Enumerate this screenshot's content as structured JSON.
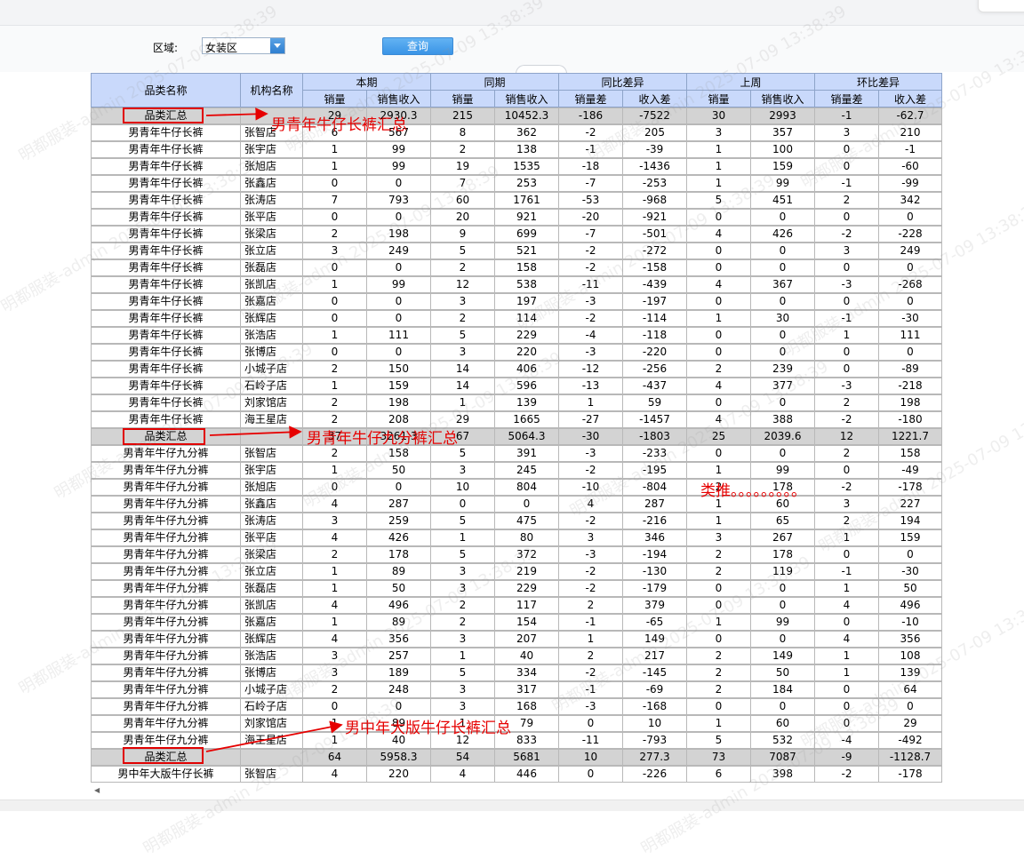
{
  "filter": {
    "region_label": "区域:",
    "region_value": "女装区",
    "query_label": "查询"
  },
  "headers": {
    "category": "品类名称",
    "store": "机构名称",
    "groups": [
      "本期",
      "同期",
      "同比差异",
      "上周",
      "环比差异"
    ],
    "sub": [
      "销量",
      "销售收入",
      "销量",
      "销售收入",
      "销量差",
      "收入差",
      "销量",
      "销售收入",
      "销量差",
      "收入差"
    ]
  },
  "rows": [
    [
      "品类汇总",
      "",
      "29",
      "2930.3",
      "215",
      "10452.3",
      "-186",
      "-7522",
      "30",
      "2993",
      "-1",
      "-62.7"
    ],
    [
      "男青年牛仔长裤",
      "张智店",
      "6",
      "567",
      "8",
      "362",
      "-2",
      "205",
      "3",
      "357",
      "3",
      "210"
    ],
    [
      "男青年牛仔长裤",
      "张宇店",
      "1",
      "99",
      "2",
      "138",
      "-1",
      "-39",
      "1",
      "100",
      "0",
      "-1"
    ],
    [
      "男青年牛仔长裤",
      "张旭店",
      "1",
      "99",
      "19",
      "1535",
      "-18",
      "-1436",
      "1",
      "159",
      "0",
      "-60"
    ],
    [
      "男青年牛仔长裤",
      "张鑫店",
      "0",
      "0",
      "7",
      "253",
      "-7",
      "-253",
      "1",
      "99",
      "-1",
      "-99"
    ],
    [
      "男青年牛仔长裤",
      "张涛店",
      "7",
      "793",
      "60",
      "1761",
      "-53",
      "-968",
      "5",
      "451",
      "2",
      "342"
    ],
    [
      "男青年牛仔长裤",
      "张平店",
      "0",
      "0",
      "20",
      "921",
      "-20",
      "-921",
      "0",
      "0",
      "0",
      "0"
    ],
    [
      "男青年牛仔长裤",
      "张梁店",
      "2",
      "198",
      "9",
      "699",
      "-7",
      "-501",
      "4",
      "426",
      "-2",
      "-228"
    ],
    [
      "男青年牛仔长裤",
      "张立店",
      "3",
      "249",
      "5",
      "521",
      "-2",
      "-272",
      "0",
      "0",
      "3",
      "249"
    ],
    [
      "男青年牛仔长裤",
      "张磊店",
      "0",
      "0",
      "2",
      "158",
      "-2",
      "-158",
      "0",
      "0",
      "0",
      "0"
    ],
    [
      "男青年牛仔长裤",
      "张凯店",
      "1",
      "99",
      "12",
      "538",
      "-11",
      "-439",
      "4",
      "367",
      "-3",
      "-268"
    ],
    [
      "男青年牛仔长裤",
      "张嘉店",
      "0",
      "0",
      "3",
      "197",
      "-3",
      "-197",
      "0",
      "0",
      "0",
      "0"
    ],
    [
      "男青年牛仔长裤",
      "张辉店",
      "0",
      "0",
      "2",
      "114",
      "-2",
      "-114",
      "1",
      "30",
      "-1",
      "-30"
    ],
    [
      "男青年牛仔长裤",
      "张浩店",
      "1",
      "111",
      "5",
      "229",
      "-4",
      "-118",
      "0",
      "0",
      "1",
      "111"
    ],
    [
      "男青年牛仔长裤",
      "张博店",
      "0",
      "0",
      "3",
      "220",
      "-3",
      "-220",
      "0",
      "0",
      "0",
      "0"
    ],
    [
      "男青年牛仔长裤",
      "小城子店",
      "2",
      "150",
      "14",
      "406",
      "-12",
      "-256",
      "2",
      "239",
      "0",
      "-89"
    ],
    [
      "男青年牛仔长裤",
      "石岭子店",
      "1",
      "159",
      "14",
      "596",
      "-13",
      "-437",
      "4",
      "377",
      "-3",
      "-218"
    ],
    [
      "男青年牛仔长裤",
      "刘家馆店",
      "2",
      "198",
      "1",
      "139",
      "1",
      "59",
      "0",
      "0",
      "2",
      "198"
    ],
    [
      "男青年牛仔长裤",
      "海王星店",
      "2",
      "208",
      "29",
      "1665",
      "-27",
      "-1457",
      "4",
      "388",
      "-2",
      "-180"
    ],
    [
      "品类汇总",
      "",
      "37",
      "3261.3",
      "67",
      "5064.3",
      "-30",
      "-1803",
      "25",
      "2039.6",
      "12",
      "1221.7"
    ],
    [
      "男青年牛仔九分裤",
      "张智店",
      "2",
      "158",
      "5",
      "391",
      "-3",
      "-233",
      "0",
      "0",
      "2",
      "158"
    ],
    [
      "男青年牛仔九分裤",
      "张宇店",
      "1",
      "50",
      "3",
      "245",
      "-2",
      "-195",
      "1",
      "99",
      "0",
      "-49"
    ],
    [
      "男青年牛仔九分裤",
      "张旭店",
      "0",
      "0",
      "10",
      "804",
      "-10",
      "-804",
      "2",
      "178",
      "-2",
      "-178"
    ],
    [
      "男青年牛仔九分裤",
      "张鑫店",
      "4",
      "287",
      "0",
      "0",
      "4",
      "287",
      "1",
      "60",
      "3",
      "227"
    ],
    [
      "男青年牛仔九分裤",
      "张涛店",
      "3",
      "259",
      "5",
      "475",
      "-2",
      "-216",
      "1",
      "65",
      "2",
      "194"
    ],
    [
      "男青年牛仔九分裤",
      "张平店",
      "4",
      "426",
      "1",
      "80",
      "3",
      "346",
      "3",
      "267",
      "1",
      "159"
    ],
    [
      "男青年牛仔九分裤",
      "张梁店",
      "2",
      "178",
      "5",
      "372",
      "-3",
      "-194",
      "2",
      "178",
      "0",
      "0"
    ],
    [
      "男青年牛仔九分裤",
      "张立店",
      "1",
      "89",
      "3",
      "219",
      "-2",
      "-130",
      "2",
      "119",
      "-1",
      "-30"
    ],
    [
      "男青年牛仔九分裤",
      "张磊店",
      "1",
      "50",
      "3",
      "229",
      "-2",
      "-179",
      "0",
      "0",
      "1",
      "50"
    ],
    [
      "男青年牛仔九分裤",
      "张凯店",
      "4",
      "496",
      "2",
      "117",
      "2",
      "379",
      "0",
      "0",
      "4",
      "496"
    ],
    [
      "男青年牛仔九分裤",
      "张嘉店",
      "1",
      "89",
      "2",
      "154",
      "-1",
      "-65",
      "1",
      "99",
      "0",
      "-10"
    ],
    [
      "男青年牛仔九分裤",
      "张辉店",
      "4",
      "356",
      "3",
      "207",
      "1",
      "149",
      "0",
      "0",
      "4",
      "356"
    ],
    [
      "男青年牛仔九分裤",
      "张浩店",
      "3",
      "257",
      "1",
      "40",
      "2",
      "217",
      "2",
      "149",
      "1",
      "108"
    ],
    [
      "男青年牛仔九分裤",
      "张博店",
      "3",
      "189",
      "5",
      "334",
      "-2",
      "-145",
      "2",
      "50",
      "1",
      "139"
    ],
    [
      "男青年牛仔九分裤",
      "小城子店",
      "2",
      "248",
      "3",
      "317",
      "-1",
      "-69",
      "2",
      "184",
      "0",
      "64"
    ],
    [
      "男青年牛仔九分裤",
      "石岭子店",
      "0",
      "0",
      "3",
      "168",
      "-3",
      "-168",
      "0",
      "0",
      "0",
      "0"
    ],
    [
      "男青年牛仔九分裤",
      "刘家馆店",
      "1",
      "89",
      "1",
      "79",
      "0",
      "10",
      "1",
      "60",
      "0",
      "29"
    ],
    [
      "男青年牛仔九分裤",
      "海王星店",
      "1",
      "40",
      "12",
      "833",
      "-11",
      "-793",
      "5",
      "532",
      "-4",
      "-492"
    ],
    [
      "品类汇总",
      "",
      "64",
      "5958.3",
      "54",
      "5681",
      "10",
      "277.3",
      "73",
      "7087",
      "-9",
      "-1128.7"
    ],
    [
      "男中年大版牛仔长裤",
      "张智店",
      "4",
      "220",
      "4",
      "446",
      "0",
      "-226",
      "6",
      "398",
      "-2",
      "-178"
    ]
  ],
  "annotations": {
    "a1": "男青年牛仔长裤汇总",
    "a2": "男青年牛仔九分裤汇总",
    "a3": "类推。。。。。。。。。",
    "a4": "男中年大版牛仔长裤汇总"
  },
  "watermark": "明都服装-admin 2025-07-09 13:38:39"
}
